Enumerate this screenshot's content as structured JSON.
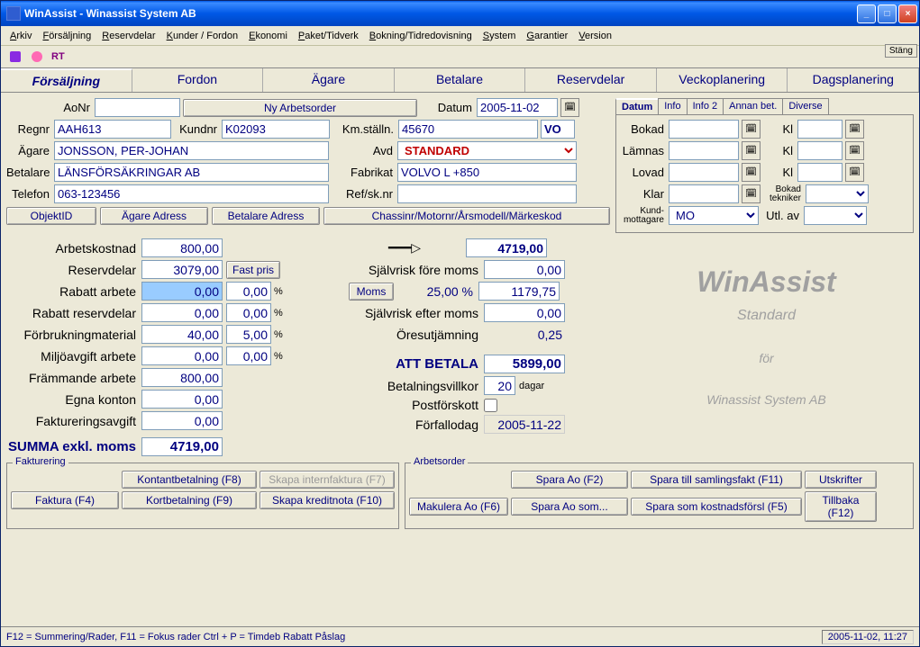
{
  "window": {
    "title": "WinAssist - Winassist System AB"
  },
  "menu": [
    "Arkiv",
    "Försäljning",
    "Reservdelar",
    "Kunder / Fordon",
    "Ekonomi",
    "Paket/Tidverk",
    "Bokning/Tidredovisning",
    "System",
    "Garantier",
    "Version"
  ],
  "stang": "Stäng",
  "toolbar": {
    "rt": "RT"
  },
  "tabs": [
    "Försäljning",
    "Fordon",
    "Ägare",
    "Betalare",
    "Reservdelar",
    "Veckoplanering",
    "Dagsplanering"
  ],
  "header": {
    "aonr_label": "AoNr",
    "aonr": "",
    "ny_arbetsorder": "Ny Arbetsorder",
    "datum_label": "Datum",
    "datum": "2005-11-02",
    "regnr_label": "Regnr",
    "regnr": "AAH613",
    "kundnr_label": "Kundnr",
    "kundnr": "K02093",
    "kmstalln_label": "Km.ställn.",
    "kmstalln": "45670",
    "vo": "VO",
    "agare_label": "Ägare",
    "agare": "JONSSON, PER-JOHAN",
    "avd_label": "Avd",
    "avd": "STANDARD",
    "betalare_label": "Betalare",
    "betalare": "LÄNSFÖRSÄKRINGAR AB",
    "fabrikat_label": "Fabrikat",
    "fabrikat": "VOLVO L +850",
    "telefon_label": "Telefon",
    "telefon": "063-123456",
    "refsk_label": "Ref/sk.nr",
    "refsk": "",
    "objektid": "ObjektID",
    "agare_adress": "Ägare Adress",
    "betalare_adress": "Betalare Adress",
    "chassinr": "Chassinr/Motornr/Årsmodell/Märkeskod"
  },
  "right_tabs": [
    "Datum",
    "Info",
    "Info 2",
    "Annan bet.",
    "Diverse"
  ],
  "right": {
    "bokad": "Bokad",
    "lamnas": "Lämnas",
    "lovad": "Lovad",
    "klar": "Klar",
    "kl": "Kl",
    "bokad_tekniker": "Bokad tekniker",
    "kundmottagare": "Kund-\nmottagare",
    "kundmott_val": "MO",
    "utl_av": "Utl. av"
  },
  "calc": {
    "arbetskostnad_label": "Arbetskostnad",
    "arbetskostnad": "800,00",
    "reservdelar_label": "Reservdelar",
    "reservdelar": "3079,00",
    "fast_pris": "Fast pris",
    "rabatt_arbete_label": "Rabatt arbete",
    "rabatt_arbete": "0,00",
    "rabatt_arbete_pct": "0,00",
    "rabatt_res_label": "Rabatt reservdelar",
    "rabatt_res": "0,00",
    "rabatt_res_pct": "0,00",
    "forbruk_label": "Förbrukningmaterial",
    "forbruk": "40,00",
    "forbruk_pct": "5,00",
    "miljo_label": "Miljöavgift arbete",
    "miljo": "0,00",
    "miljo_pct": "0,00",
    "frammande_label": "Främmande arbete",
    "frammande": "800,00",
    "egna_label": "Egna konton",
    "egna": "0,00",
    "faktavg_label": "Faktureringsavgift",
    "faktavg": "0,00",
    "summa_label": "SUMMA exkl. moms",
    "summa": "4719,00",
    "pct": "%",
    "total": "4719,00",
    "sjalvrisk_fore_label": "Självrisk före moms",
    "sjalvrisk_fore": "0,00",
    "moms_btn": "Moms",
    "moms_pct": "25,00 %",
    "moms": "1179,75",
    "sjalvrisk_efter_label": "Självrisk efter moms",
    "sjalvrisk_efter": "0,00",
    "oresutj_label": "Öresutjämning",
    "oresutj": "0,25",
    "att_betala_label": "ATT BETALA",
    "att_betala": "5899,00",
    "betvillkor_label": "Betalningsvillkor",
    "betvillkor": "20",
    "dagar": "dagar",
    "postforskott_label": "Postförskott",
    "forfallodag_label": "Förfallodag",
    "forfallodag": "2005-11-22"
  },
  "watermark": {
    "logo": "WinAssist",
    "std": "Standard",
    "for": "för",
    "company": "Winassist System AB"
  },
  "groups": {
    "fakturering": "Fakturering",
    "arbetsorder": "Arbetsorder"
  },
  "buttons": {
    "kontant": "Kontantbetalning (F8)",
    "intern": "Skapa internfaktura (F7)",
    "faktura": "Faktura (F4)",
    "kort": "Kortbetalning (F9)",
    "kredit": "Skapa kreditnota (F10)",
    "spara_ao": "Spara Ao (F2)",
    "spara_saml": "Spara till samlingsfakt (F11)",
    "utskrifter": "Utskrifter",
    "makulera": "Makulera Ao (F6)",
    "spara_som": "Spara Ao som...",
    "spara_kost": "Spara som kostnadsförsl (F5)",
    "tillbaka": "Tillbaka (F12)"
  },
  "status": {
    "left": "F12 = Summering/Rader, F11 = Fokus rader  Ctrl + P = Timdeb Rabatt Påslag",
    "right": "2005-11-02, 11:27"
  }
}
